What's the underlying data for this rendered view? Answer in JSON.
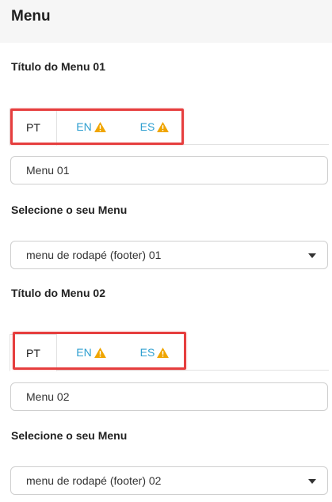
{
  "header": {
    "title": "Menu"
  },
  "menus": [
    {
      "title_label": "Título do Menu 01",
      "tabs": [
        "PT",
        "EN",
        "ES"
      ],
      "input_value": "Menu 01",
      "select_label": "Selecione o seu Menu",
      "select_value": "menu de rodapé (footer) 01"
    },
    {
      "title_label": "Título do Menu 02",
      "tabs": [
        "PT",
        "EN",
        "ES"
      ],
      "input_value": "Menu 02",
      "select_label": "Selecione o seu Menu",
      "select_value": "menu de rodapé (footer) 02"
    }
  ],
  "colors": {
    "link": "#2e9fd0",
    "warning": "#f0a500",
    "highlight": "#e63e3e"
  },
  "icons": {
    "tab_status": "warning-icon",
    "select_toggle": "chevron-down-icon"
  }
}
